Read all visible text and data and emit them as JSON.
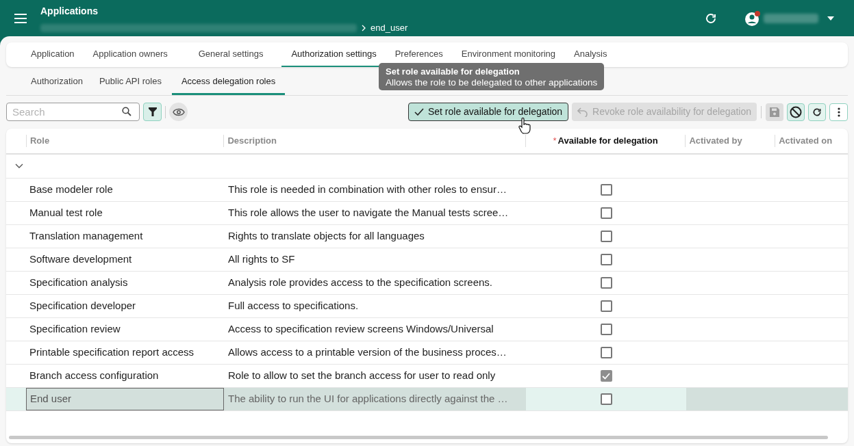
{
  "header": {
    "title": "Applications",
    "breadcrumb_current": "end_user"
  },
  "tabs": [
    {
      "label": "Application",
      "selected": false
    },
    {
      "label": "Application owners",
      "selected": false
    },
    {
      "label": "General settings",
      "selected": false
    },
    {
      "label": "Authorization settings",
      "selected": true
    },
    {
      "label": "Preferences",
      "selected": false
    },
    {
      "label": "Environment monitoring",
      "selected": false
    },
    {
      "label": "Analysis",
      "selected": false
    }
  ],
  "subtabs": [
    {
      "label": "Authorization",
      "selected": false
    },
    {
      "label": "Public API roles",
      "selected": false
    },
    {
      "label": "Access delegation roles",
      "selected": true
    }
  ],
  "tooltip": {
    "title": "Set role available for delegation",
    "text": "Allows the role to be delegated to other applications"
  },
  "toolbar": {
    "search": {
      "placeholder": "Search"
    },
    "buttons": [
      {
        "label": "Set role available for delegation",
        "disabled": false
      },
      {
        "label": "Revoke role availability for delegation",
        "disabled": true
      }
    ]
  },
  "table": {
    "columns": [
      {
        "label": "Role"
      },
      {
        "label": "Description"
      },
      {
        "label": "Available for delegation",
        "required_mark": "*"
      },
      {
        "label": "Activated by"
      },
      {
        "label": "Activated on"
      }
    ],
    "rows": [
      {
        "role": "Base modeler role",
        "description": "This role is needed in combination with other roles to ensur…",
        "available": false,
        "selected": false
      },
      {
        "role": "Manual test role",
        "description": "This role allows the user to navigate the Manual tests scree…",
        "available": false,
        "selected": false
      },
      {
        "role": "Translation management",
        "description": "Rights to translate objects for all languages",
        "available": false,
        "selected": false
      },
      {
        "role": "Software development",
        "description": "All rights to SF",
        "available": false,
        "selected": false
      },
      {
        "role": "Specification analysis",
        "description": "Analysis role provides access to the specification screens.",
        "available": false,
        "selected": false
      },
      {
        "role": "Specification developer",
        "description": "Full access to specifications.",
        "available": false,
        "selected": false
      },
      {
        "role": "Specification review",
        "description": "Access to specification review screens Windows/Universal",
        "available": false,
        "selected": false
      },
      {
        "role": "Printable specification report access",
        "description": "Allows access to a printable version of the business proces…",
        "available": false,
        "selected": false
      },
      {
        "role": "Branch access configuration",
        "description": "Role to allow to set the branch access for user to read only",
        "available": true,
        "selected": false
      },
      {
        "role": "End user",
        "description": "The ability to run the UI for applications directly against the …",
        "available": false,
        "selected": true
      }
    ]
  }
}
